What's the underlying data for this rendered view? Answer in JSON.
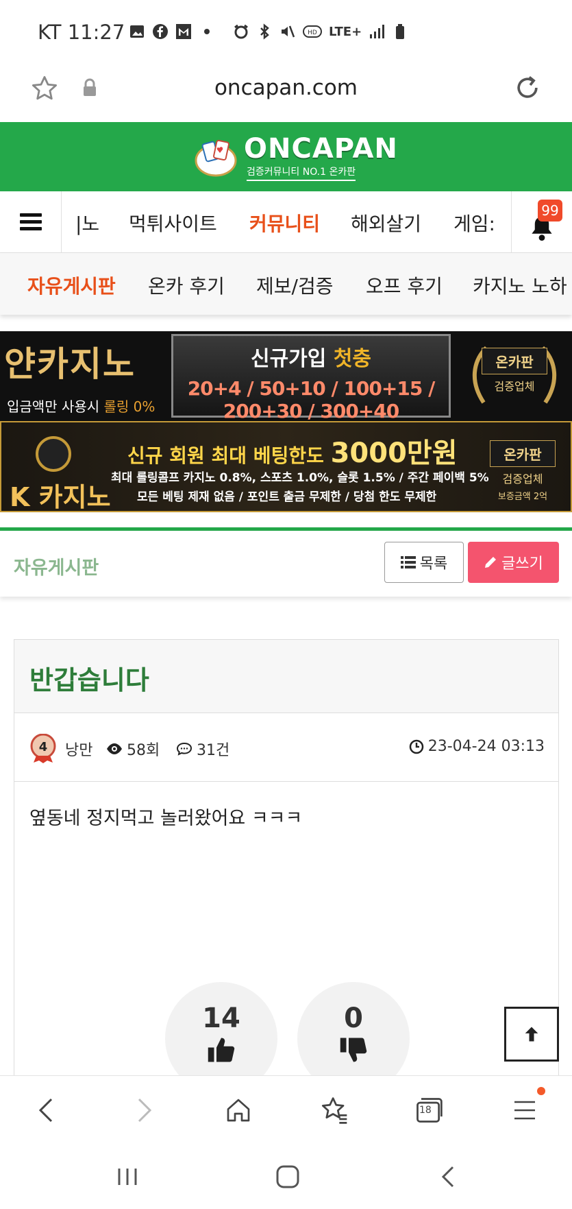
{
  "status_bar": {
    "carrier": "KT",
    "time": "11:27",
    "left_icons": [
      "image-icon",
      "facebook-icon",
      "gmail-icon",
      "dot-icon"
    ],
    "right_icons": [
      "alarm-icon",
      "bluetooth-icon",
      "mute-icon",
      "hd-icon",
      "lte-icon",
      "signal-icon",
      "battery-icon"
    ],
    "network": "LTE+"
  },
  "url_bar": {
    "url": "oncapan.com",
    "favorite_icon": "star-icon",
    "lock_icon": "lock-icon",
    "reload_icon": "reload-icon"
  },
  "site": {
    "logo_text": "ONCAPAN",
    "logo_sub": "검증커뮤니티 NO.1 온카판",
    "brand_color": "#24a84a"
  },
  "main_nav": {
    "items": [
      {
        "label": "|노",
        "active": false
      },
      {
        "label": "먹튀사이트",
        "active": false
      },
      {
        "label": "커뮤니티",
        "active": true
      },
      {
        "label": "해외살기",
        "active": false
      },
      {
        "label": "게임:",
        "active": false
      }
    ],
    "notification_count": "99"
  },
  "sub_nav": {
    "items": [
      {
        "label": "자유게시판",
        "active": true
      },
      {
        "label": "온카 후기",
        "active": false
      },
      {
        "label": "제보/검증",
        "active": false
      },
      {
        "label": "오프 후기",
        "active": false
      },
      {
        "label": "카지노 노하",
        "active": false
      }
    ]
  },
  "banner1": {
    "left_title": "얀카지노",
    "left_sub_prefix": "입금액만 사용시 ",
    "left_sub_highlight": "롤링 0%",
    "center_title_prefix": "신규가입 ",
    "center_title_highlight": "첫충",
    "center_numbers": "20+4 / 50+10 / 100+15 / 200+30 / 300+40",
    "badge_line1": "온카판",
    "badge_line2": "검증업체"
  },
  "banner2": {
    "left_title": "K 카지노",
    "title_prefix": "신규 회원 최대 베팅한도 ",
    "title_highlight": "3000만원",
    "line1": "최대 롤링콤프 카지노 0.8%, 스포츠 1.0%, 슬롯 1.5% / 주간 페이백 5%",
    "line2": "모든 베팅 제재 없음 / 포인트 출금 무제한 / 당첨 한도 무제한",
    "badge_line1": "온카판",
    "badge_line2": "검증업체",
    "badge_line3": "보증금액 2억"
  },
  "board": {
    "title": "자유게시판",
    "list_button": "목록",
    "write_button": "글쓰기"
  },
  "post": {
    "title": "반갑습니다",
    "author_level": "4",
    "author": "낭만",
    "views": "58회",
    "comments": "31건",
    "date": "23-04-24 03:13",
    "body": "옆동네 정지먹고 놀러왔어요 ㅋㅋㅋ",
    "likes": "14",
    "dislikes": "0"
  },
  "browser_bar": {
    "tabs_count": "18",
    "buttons": [
      "back-icon",
      "forward-icon",
      "home-icon",
      "bookmarks-icon",
      "tabs-icon",
      "menu-icon"
    ]
  },
  "system_nav": {
    "buttons": [
      "recents-icon",
      "home-icon",
      "back-icon"
    ]
  }
}
